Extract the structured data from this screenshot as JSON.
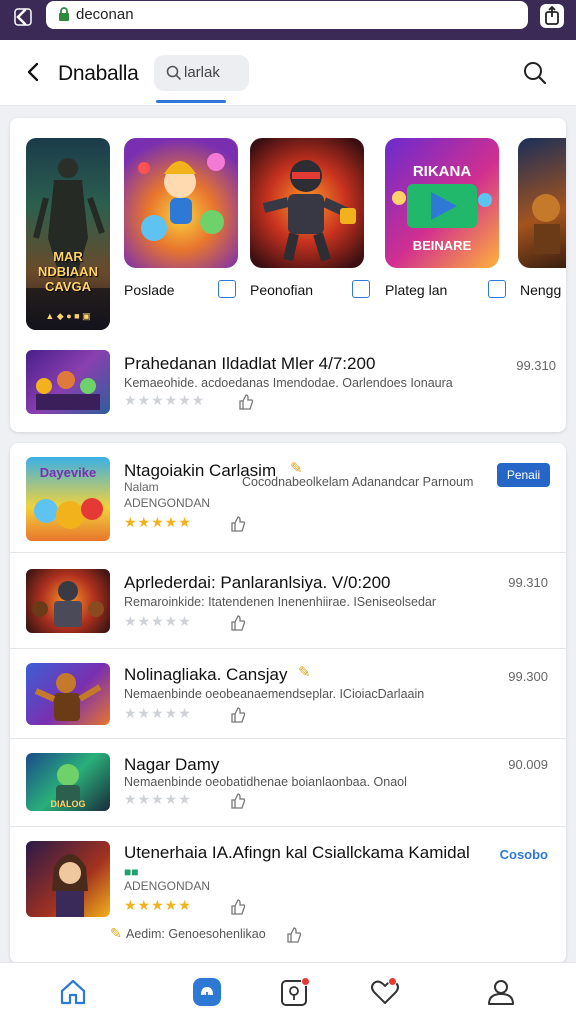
{
  "browser": {
    "url": "deconan"
  },
  "header": {
    "title": "Dnaballa",
    "search_label": "larlak"
  },
  "featured": {
    "big_title": "MAR NDBIAAN CAVGA",
    "big_small": "▲ ◆ ● ■ ▣",
    "tiles": [
      {
        "caption": "Poslade"
      },
      {
        "caption": "Peonofian"
      },
      {
        "caption": "Plateg lan"
      },
      {
        "caption": "Nengg"
      }
    ],
    "row": {
      "title": "Prahedanan Ildadlat Mler 4/7:200",
      "subtitle": "Kemaeohide. acdoedanas Imendodae. Oarlendoes Ionaura",
      "price": "99.310"
    }
  },
  "list": [
    {
      "title": "Ntagoiakin Carlasim",
      "subtitle": "Nalam",
      "subtitle2": "ADENGONDAN",
      "desc": "Cocodnabeolkelam Adanandcar Parnoum",
      "button": "Penaii",
      "stars": "★★★★★",
      "rated": true
    },
    {
      "title": "Aprlederdai: Panlaranlsiya. V/0:200",
      "subtitle": "Remaroinkide: Itatendenen Inenenhiirae. ISeniseolsedar",
      "price": "99.310",
      "stars": "★★★★★",
      "rated": false
    },
    {
      "title": "Nolinagliaka. Cansjay",
      "subtitle": "Nemaenbinde oeobeanaemendseplar. ICioiacDarlaain",
      "price": "99.300",
      "stars": "★★★★★",
      "rated": false
    },
    {
      "title": "Nagar Damy",
      "subtitle": "Nemaenbinde oeobatidhenae boianlaonbaa. Onaol",
      "price": "90.009",
      "stars": "★★★★★",
      "rated": false
    },
    {
      "title": "Utenerhaia IA.Afingn kal Csiallckama Kamidal",
      "subtitle": "■■",
      "subtitle2": "ADENGONDAN",
      "price": "Cosobo",
      "stars": "★★★★★",
      "rated": true,
      "footer": "Aedim: Genoesohenlikao"
    }
  ],
  "colors": {
    "accent": "#2f79d6",
    "browser_bar": "#3b2a55",
    "star": "#f2b21b",
    "badge": "#e53935"
  }
}
